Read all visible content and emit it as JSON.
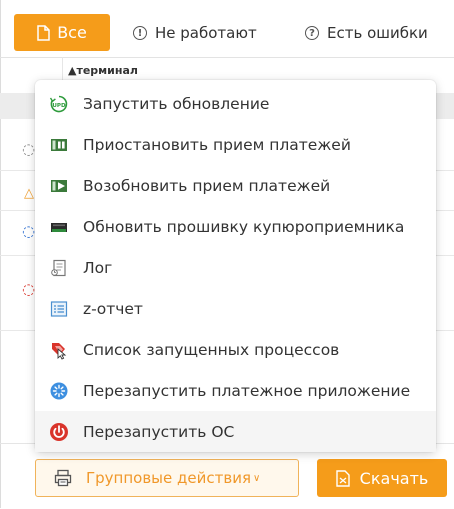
{
  "filters": {
    "all_label": "Все",
    "not_working_label": "Не работают",
    "has_errors_label": "Есть ошибки"
  },
  "table": {
    "column_title": "▲терминал"
  },
  "menu": {
    "items": [
      {
        "label": "Запустить обновление",
        "icon": "update-upd-icon"
      },
      {
        "label": "Приостановить прием платежей",
        "icon": "pause-payments-icon"
      },
      {
        "label": "Возобновить прием платежей",
        "icon": "resume-payments-icon"
      },
      {
        "label": "Обновить прошивку купюроприемника",
        "icon": "bill-acceptor-firmware-icon"
      },
      {
        "label": "Лог",
        "icon": "log-document-icon"
      },
      {
        "label": "z-отчет",
        "icon": "z-report-icon"
      },
      {
        "label": "Список запущенных процессов",
        "icon": "process-list-icon"
      },
      {
        "label": "Перезапустить платежное приложение",
        "icon": "restart-app-icon"
      },
      {
        "label": "Перезапустить ОС",
        "icon": "power-icon"
      }
    ]
  },
  "actions": {
    "group_actions_label": "Групповые действия",
    "download_label": "Скачать"
  },
  "colors": {
    "accent": "#f59c1a",
    "accent_light": "#fff8ec",
    "power_red": "#d9342b"
  }
}
